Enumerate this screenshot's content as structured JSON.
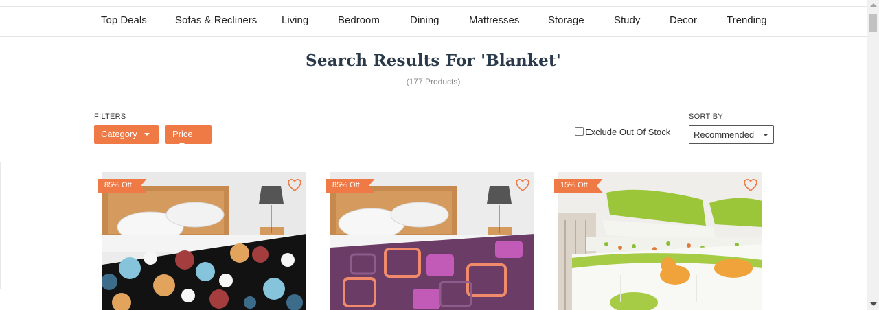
{
  "nav": {
    "items": [
      {
        "label": "Top Deals"
      },
      {
        "label": "Sofas & Recliners"
      },
      {
        "label": "Living"
      },
      {
        "label": "Bedroom"
      },
      {
        "label": "Dining"
      },
      {
        "label": "Mattresses"
      },
      {
        "label": "Storage"
      },
      {
        "label": "Study"
      },
      {
        "label": "Decor"
      },
      {
        "label": "Trending"
      }
    ]
  },
  "search": {
    "title": "Search Results For 'Blanket'",
    "count": "(177 Products)"
  },
  "filters": {
    "label": "FILTERS",
    "category_label": "Category",
    "price_label": "Price",
    "exclude_label": "Exclude Out Of Stock",
    "exclude_checked": false
  },
  "sort": {
    "label": "SORT BY",
    "selected": "Recommended"
  },
  "products": [
    {
      "badge": "85% Off",
      "image": "blanket-semicircle-pattern"
    },
    {
      "badge": "85% Off",
      "image": "blanket-purple-squares"
    },
    {
      "badge": "15% Off",
      "image": "blanket-kids-animals"
    }
  ],
  "colors": {
    "accent": "#ef7a46",
    "heart": "#ef7a46",
    "title": "#2b3a4a"
  }
}
